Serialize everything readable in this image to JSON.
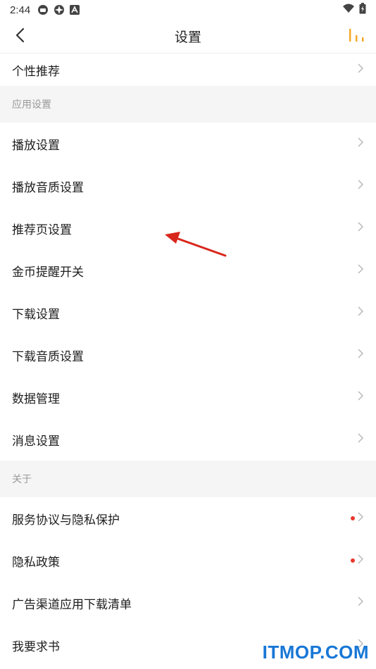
{
  "status_bar": {
    "time": "2:44"
  },
  "nav": {
    "title": "设置"
  },
  "top_item": {
    "label": "个性推荐"
  },
  "sections": [
    {
      "header": "应用设置",
      "items": [
        "播放设置",
        "播放音质设置",
        "推荐页设置",
        "金币提醒开关",
        "下载设置",
        "下载音质设置",
        "数据管理",
        "消息设置"
      ]
    },
    {
      "header": "关于",
      "items": [
        "服务协议与隐私保护",
        "隐私政策",
        "广告渠道应用下载清单",
        "我要求书"
      ]
    }
  ],
  "colors": {
    "accent": "#f5a623",
    "dot": "#e8372e",
    "arrow": "#d9261c",
    "watermark": "#1877d6"
  },
  "watermark": "ITMOP.COM"
}
